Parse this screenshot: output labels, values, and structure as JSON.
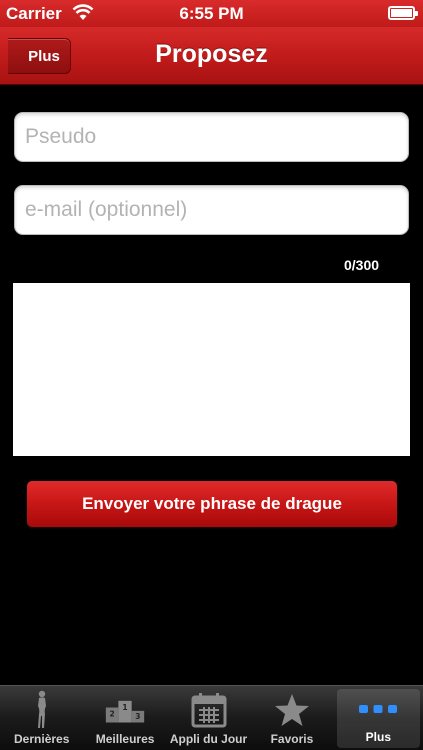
{
  "status_bar": {
    "carrier": "Carrier",
    "time": "6:55 PM"
  },
  "nav": {
    "back_label": "Plus",
    "title": "Proposez"
  },
  "form": {
    "pseudo_placeholder": "Pseudo",
    "email_placeholder": "e-mail (optionnel)",
    "counter": "0/300",
    "submit_label": "Envoyer votre phrase de drague"
  },
  "tabbar": {
    "tabs": [
      {
        "label": "Dernières",
        "icon": "woman-silhouette-icon",
        "active": false
      },
      {
        "label": "Meilleures",
        "icon": "podium-icon",
        "active": false
      },
      {
        "label": "Appli du Jour",
        "icon": "calendar-icon",
        "active": false
      },
      {
        "label": "Favoris",
        "icon": "star-icon",
        "active": false
      },
      {
        "label": "Plus",
        "icon": "more-dots-icon",
        "active": true
      }
    ]
  },
  "colors": {
    "brand_red": "#c21b1b",
    "background": "#000000",
    "placeholder": "#b3b3b3"
  }
}
